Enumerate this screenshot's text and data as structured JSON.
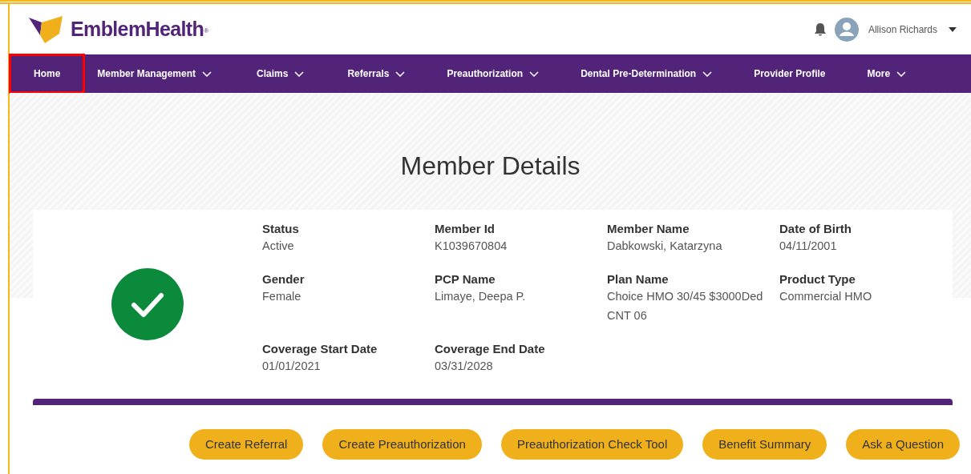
{
  "header": {
    "logo_text": "EmblemHealth",
    "logo_mark": "®",
    "user_name": "Allison Richards"
  },
  "nav": [
    {
      "label": "Home",
      "dropdown": false,
      "annotated": true
    },
    {
      "label": "Member Management",
      "dropdown": true,
      "annotated": false
    },
    {
      "label": "Claims",
      "dropdown": true,
      "annotated": false
    },
    {
      "label": "Referrals",
      "dropdown": true,
      "annotated": false
    },
    {
      "label": "Preauthorization",
      "dropdown": true,
      "annotated": false
    },
    {
      "label": "Dental Pre-Determination",
      "dropdown": true,
      "annotated": false
    },
    {
      "label": "Provider Profile",
      "dropdown": false,
      "annotated": false
    },
    {
      "label": "More",
      "dropdown": true,
      "annotated": false
    }
  ],
  "title": "Member Details",
  "member": {
    "status_ok": true,
    "fields": [
      {
        "label": "Status",
        "value": "Active"
      },
      {
        "label": "Member Id",
        "value": "K1039670804"
      },
      {
        "label": "Member Name",
        "value": "Dabkowski, Katarzyna"
      },
      {
        "label": "Date of Birth",
        "value": "04/11/2001"
      },
      {
        "label": "Gender",
        "value": "Female"
      },
      {
        "label": "PCP Name",
        "value": "Limaye, Deepa P."
      },
      {
        "label": "Plan Name",
        "value": "Choice HMO 30/45 $3000Ded CNT 06"
      },
      {
        "label": "Product Type",
        "value": "Commercial HMO"
      },
      {
        "label": "Coverage Start Date",
        "value": "01/01/2021"
      },
      {
        "label": "Coverage End Date",
        "value": "03/31/2028"
      }
    ]
  },
  "actions": [
    "Create Referral",
    "Create Preauthorization",
    "Preauthorization Check Tool",
    "Benefit Summary",
    "Ask a Question"
  ]
}
